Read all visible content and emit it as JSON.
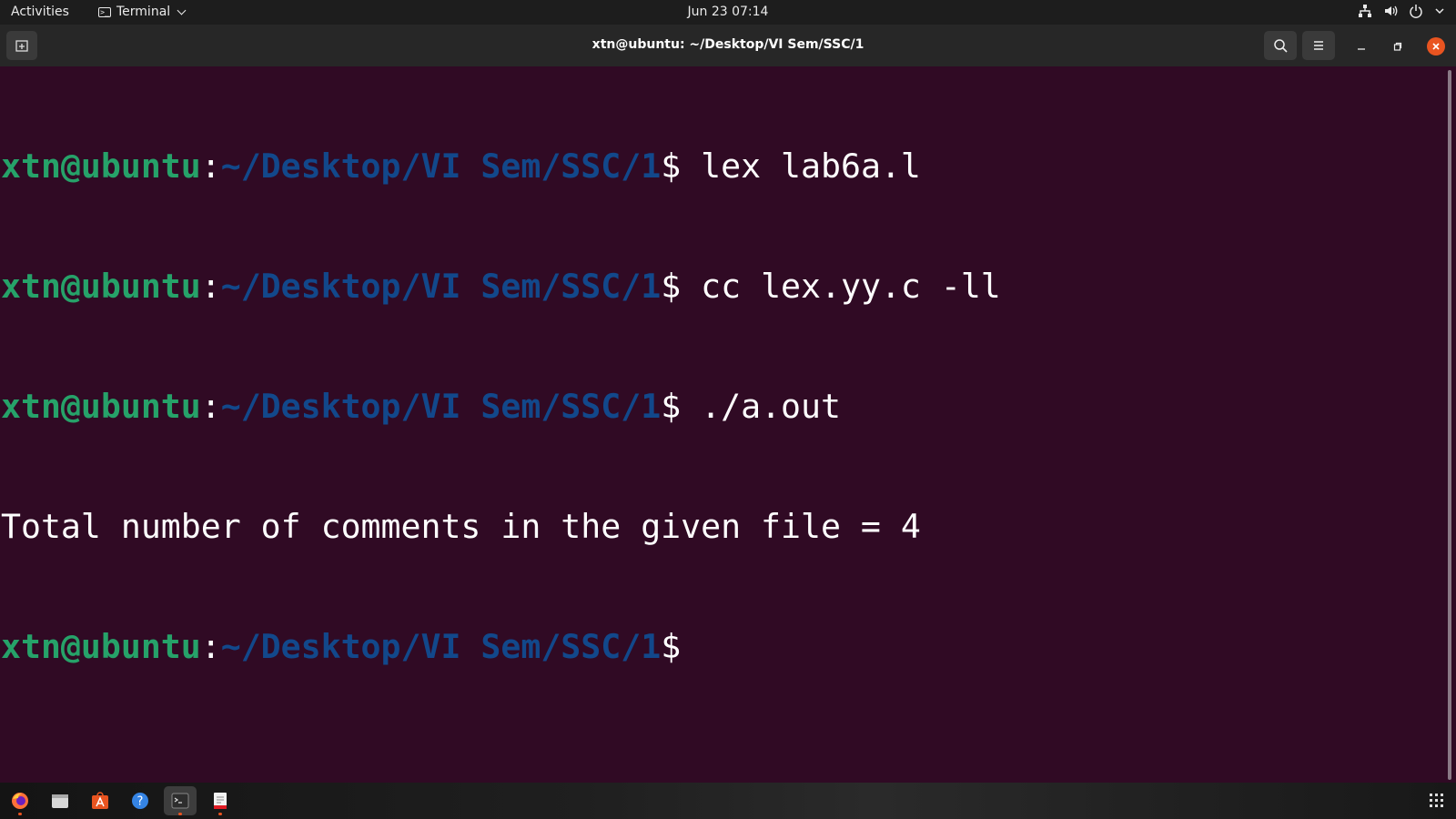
{
  "topbar": {
    "activities": "Activities",
    "app_name": "Terminal",
    "clock": "Jun 23  07:14"
  },
  "window": {
    "title": "xtn@ubuntu: ~/Desktop/VI Sem/SSC/1"
  },
  "terminal": {
    "user_host": "xtn@ubuntu",
    "path": "~/Desktop/VI Sem/SSC/1",
    "prompt_symbol": "$",
    "commands": [
      "lex lab6a.l",
      "cc lex.yy.c -ll",
      "./a.out"
    ],
    "output": "Total number of comments in the given file = 4",
    "colors": {
      "background": "#300a24",
      "user": "#26a269",
      "path": "#12488b",
      "text": "#ffffff"
    }
  },
  "dock": {
    "items": [
      "firefox-icon",
      "files-icon",
      "software-center-icon",
      "help-icon",
      "terminal-icon",
      "text-editor-icon"
    ],
    "accent": "#e95420"
  }
}
